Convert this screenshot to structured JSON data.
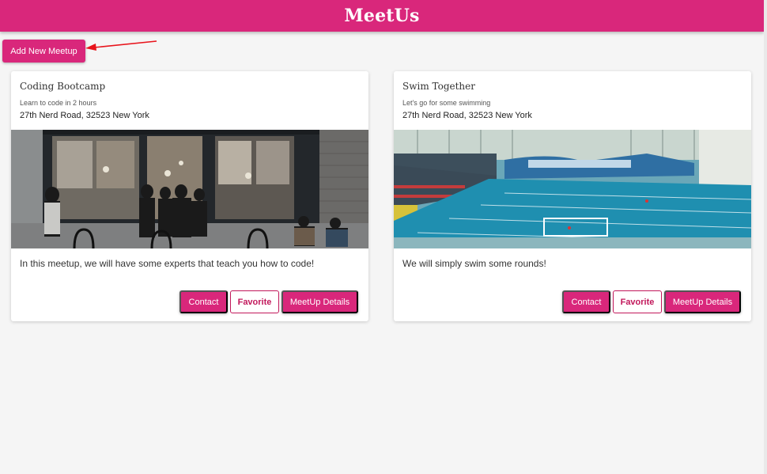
{
  "header": {
    "title": "MeetUs"
  },
  "toolbar": {
    "add_label": "Add New Meetup"
  },
  "meetups": [
    {
      "title": "Coding Bootcamp",
      "subtitle": "Learn to code in 2 hours",
      "address": "27th Nerd Road, 32523 New York",
      "description": "In this meetup, we will have some experts that teach you how to code!",
      "image": "cafe-storefront-photo",
      "actions": {
        "contact": "Contact",
        "favorite": "Favorite",
        "details": "MeetUp Details"
      }
    },
    {
      "title": "Swim Together",
      "subtitle": "Let's go for some swimming",
      "address": "27th Nerd Road, 32523 New York",
      "description": "We will simply swim some rounds!",
      "image": "swimming-pool-photo",
      "actions": {
        "contact": "Contact",
        "favorite": "Favorite",
        "details": "MeetUp Details"
      }
    }
  ],
  "colors": {
    "accent": "#d9277b",
    "background": "#f5f5f5",
    "annotation_arrow": "#e8141c"
  }
}
